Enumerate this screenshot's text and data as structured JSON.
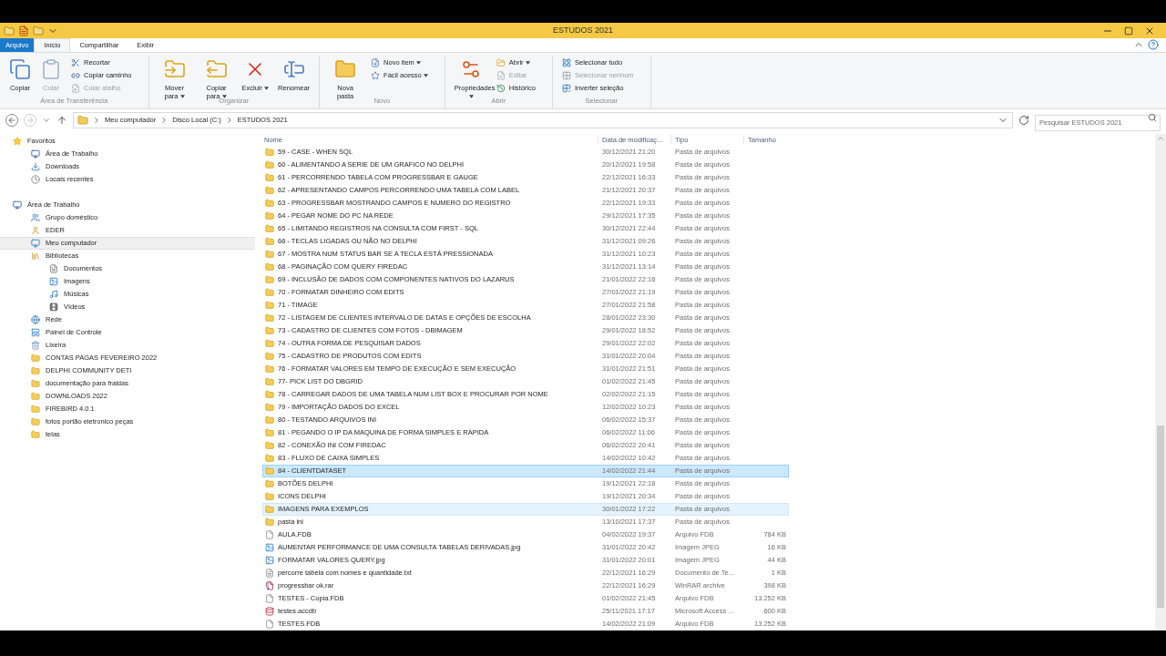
{
  "window": {
    "title": "ESTUDOS 2021"
  },
  "ribbon_tabs": [
    {
      "label": "Arquivo",
      "kind": "file",
      "selected": false
    },
    {
      "label": "Início",
      "kind": "tab",
      "selected": true
    },
    {
      "label": "Compartilhar",
      "kind": "tab",
      "selected": false
    },
    {
      "label": "Exibir",
      "kind": "tab",
      "selected": false
    }
  ],
  "ribbon_groups": [
    {
      "label": "Área de Transferência",
      "items": [
        {
          "label": "Copiar",
          "kind": "large",
          "disabled": false,
          "dropdown": false
        },
        {
          "label": "Colar",
          "kind": "large",
          "disabled": true,
          "dropdown": false
        },
        {
          "label": "Recortar",
          "kind": "small",
          "disabled": false,
          "dropdown": false
        },
        {
          "label": "Copiar caminho",
          "kind": "small",
          "disabled": false,
          "dropdown": false
        },
        {
          "label": "Colar atalho",
          "kind": "small",
          "disabled": true,
          "dropdown": false
        }
      ]
    },
    {
      "label": "Organizar",
      "items": [
        {
          "label": "Mover para",
          "kind": "large",
          "disabled": false,
          "dropdown": true
        },
        {
          "label": "Copiar para",
          "kind": "large",
          "disabled": false,
          "dropdown": true
        },
        {
          "label": "Excluir",
          "kind": "large",
          "disabled": false,
          "dropdown": true
        },
        {
          "label": "Renomear",
          "kind": "large",
          "disabled": false,
          "dropdown": false
        }
      ]
    },
    {
      "label": "Novo",
      "items": [
        {
          "label": "Nova pasta",
          "kind": "large",
          "disabled": false,
          "dropdown": false
        },
        {
          "label": "Novo item",
          "kind": "small",
          "disabled": false,
          "dropdown": true
        },
        {
          "label": "Fácil acesso",
          "kind": "small",
          "disabled": false,
          "dropdown": true
        }
      ]
    },
    {
      "label": "Abrir",
      "items": [
        {
          "label": "Propriedades",
          "kind": "large",
          "disabled": false,
          "dropdown": true
        },
        {
          "label": "Abrir",
          "kind": "small",
          "disabled": false,
          "dropdown": true
        },
        {
          "label": "Editar",
          "kind": "small",
          "disabled": true,
          "dropdown": false
        },
        {
          "label": "Histórico",
          "kind": "small",
          "disabled": false,
          "dropdown": false
        }
      ]
    },
    {
      "label": "Selecionar",
      "items": [
        {
          "label": "Selecionar tudo",
          "kind": "small",
          "disabled": false,
          "dropdown": false
        },
        {
          "label": "Selecionar nenhum",
          "kind": "small",
          "disabled": true,
          "dropdown": false
        },
        {
          "label": "Inverter seleção",
          "kind": "small",
          "disabled": false,
          "dropdown": false
        }
      ]
    }
  ],
  "address_bar": {
    "path": [
      "Meu computador",
      "Disco Local (C:)",
      "ESTUDOS 2021"
    ],
    "search_placeholder": "Pesquisar ESTUDOS 2021"
  },
  "sidebar": [
    {
      "label": "Favoritos",
      "kind": "star",
      "selected": false,
      "children": [
        {
          "label": "Área de Trabalho",
          "kind": "desktop",
          "selected": false
        },
        {
          "label": "Downloads",
          "kind": "download",
          "selected": false
        },
        {
          "label": "Locais recentes",
          "kind": "recent",
          "selected": false
        }
      ]
    },
    {
      "label": "Área de Trabalho",
      "kind": "desktop",
      "selected": false,
      "children": [
        {
          "label": "Grupo doméstico",
          "kind": "homegroup",
          "selected": false
        },
        {
          "label": "EDER",
          "kind": "user",
          "selected": false
        },
        {
          "label": "Meu computador",
          "kind": "computer",
          "selected": true
        },
        {
          "label": "Bibliotecas",
          "kind": "library",
          "selected": false,
          "children": [
            {
              "label": "Documentos",
              "kind": "document",
              "selected": false
            },
            {
              "label": "Imagens",
              "kind": "image",
              "selected": false
            },
            {
              "label": "Músicas",
              "kind": "music",
              "selected": false
            },
            {
              "label": "Vídeos",
              "kind": "video",
              "selected": false
            }
          ]
        },
        {
          "label": "Rede",
          "kind": "network",
          "selected": false
        },
        {
          "label": "Painel de Controle",
          "kind": "control",
          "selected": false
        },
        {
          "label": "Lixeira",
          "kind": "trash",
          "selected": false
        },
        {
          "label": "CONTAS PAGAS FEVEREIRO 2022",
          "kind": "folder",
          "selected": false
        },
        {
          "label": "DELPHI COMMUNITY DETI",
          "kind": "folder",
          "selected": false
        },
        {
          "label": "documentação para fraldas",
          "kind": "folder",
          "selected": false
        },
        {
          "label": "DOWNLOADS 2022",
          "kind": "folder",
          "selected": false
        },
        {
          "label": "FIREBIRD 4.0.1",
          "kind": "folder",
          "selected": false
        },
        {
          "label": "fotos portão eletronico peças",
          "kind": "folder",
          "selected": false
        },
        {
          "label": "telas",
          "kind": "folder",
          "selected": false
        }
      ]
    }
  ],
  "table": {
    "columns": [
      "Nome",
      "Data de modificaç...",
      "Tipo",
      "Tamanho"
    ],
    "rows": [
      {
        "name": "59 - CASE - WHEN SQL",
        "date": "30/12/2021 21:20",
        "type": "Pasta de arquivos",
        "kind": "folder",
        "selected": false,
        "hovered": false
      },
      {
        "name": "60 - ALIMENTANDO A SERIE DE UM GRAFICO NO DELPHI",
        "date": "20/12/2021 19:58",
        "type": "Pasta de arquivos",
        "kind": "folder",
        "selected": false,
        "hovered": false
      },
      {
        "name": "61 - PERCORRENDO TABELA COM PROGRESSBAR E GAUGE",
        "date": "22/12/2021 16:33",
        "type": "Pasta de arquivos",
        "kind": "folder",
        "selected": false,
        "hovered": false
      },
      {
        "name": "62 - APRESENTANDO CAMPOS PERCORRENDO UMA TABELA COM LABEL",
        "date": "21/12/2021 20:37",
        "type": "Pasta de arquivos",
        "kind": "folder",
        "selected": false,
        "hovered": false
      },
      {
        "name": "63 - PROGRESSBAR MOSTRANDO CAMPOS E NUMERO DO REGISTRO",
        "date": "22/12/2021 19:33",
        "type": "Pasta de arquivos",
        "kind": "folder",
        "selected": false,
        "hovered": false
      },
      {
        "name": "64 - PEGAR NOME DO PC NA REDE",
        "date": "29/12/2021 17:35",
        "type": "Pasta de arquivos",
        "kind": "folder",
        "selected": false,
        "hovered": false
      },
      {
        "name": "65 - LIMITANDO REGISTROS NA CONSULTA COM FIRST - SQL",
        "date": "30/12/2021 22:44",
        "type": "Pasta de arquivos",
        "kind": "folder",
        "selected": false,
        "hovered": false
      },
      {
        "name": "66 - TECLAS LIGADAS OU NÃO NO DELPHI",
        "date": "31/12/2021 09:26",
        "type": "Pasta de arquivos",
        "kind": "folder",
        "selected": false,
        "hovered": false
      },
      {
        "name": "67 - MOSTRA NUM STATUS BAR SE A TECLA ESTÁ PRESSIONADA",
        "date": "31/12/2021 10:23",
        "type": "Pasta de arquivos",
        "kind": "folder",
        "selected": false,
        "hovered": false
      },
      {
        "name": "68 - PAGINAÇÃO COM QUERY FIREDAC",
        "date": "31/12/2021 13:14",
        "type": "Pasta de arquivos",
        "kind": "folder",
        "selected": false,
        "hovered": false
      },
      {
        "name": "69 - INCLUSÃO DE DADOS COM COMPONENTES NATIVOS DO LAZARUS",
        "date": "21/01/2022 22:16",
        "type": "Pasta de arquivos",
        "kind": "folder",
        "selected": false,
        "hovered": false
      },
      {
        "name": "70 - FORMATAR DINHEIRO COM EDITS",
        "date": "27/01/2022 21:19",
        "type": "Pasta de arquivos",
        "kind": "folder",
        "selected": false,
        "hovered": false
      },
      {
        "name": "71 - TIMAGE",
        "date": "27/01/2022 21:58",
        "type": "Pasta de arquivos",
        "kind": "folder",
        "selected": false,
        "hovered": false
      },
      {
        "name": "72 - LISTAGEM DE CLIENTES INTERVALO DE DATAS E OPÇÕES DE ESCOLHA",
        "date": "28/01/2022 23:30",
        "type": "Pasta de arquivos",
        "kind": "folder",
        "selected": false,
        "hovered": false
      },
      {
        "name": "73 - CADASTRO DE CLIENTES COM FOTOS - DBIMAGEM",
        "date": "29/01/2022 18:52",
        "type": "Pasta de arquivos",
        "kind": "folder",
        "selected": false,
        "hovered": false
      },
      {
        "name": "74 - OUTRA FORMA DE PESQUISAR DADOS",
        "date": "29/01/2022 22:02",
        "type": "Pasta de arquivos",
        "kind": "folder",
        "selected": false,
        "hovered": false
      },
      {
        "name": "75 - CADASTRO DE PRODUTOS COM EDITS",
        "date": "31/01/2022 20:04",
        "type": "Pasta de arquivos",
        "kind": "folder",
        "selected": false,
        "hovered": false
      },
      {
        "name": "76 - FORMATAR VALORES EM TEMPO DE EXECUÇÃO E SEM EXECUÇÃO",
        "date": "31/01/2022 21:51",
        "type": "Pasta de arquivos",
        "kind": "folder",
        "selected": false,
        "hovered": false
      },
      {
        "name": "77- PICK LIST DO DBGRID",
        "date": "01/02/2022 21:45",
        "type": "Pasta de arquivos",
        "kind": "folder",
        "selected": false,
        "hovered": false
      },
      {
        "name": "78 - CARREGAR DADOS DE UMA TABELA NUM LIST BOX E PROCURAR POR NOME",
        "date": "02/02/2022 21:15",
        "type": "Pasta de arquivos",
        "kind": "folder",
        "selected": false,
        "hovered": false
      },
      {
        "name": "79 - IMPORTAÇÃO DADOS DO EXCEL",
        "date": "12/02/2022 10:23",
        "type": "Pasta de arquivos",
        "kind": "folder",
        "selected": false,
        "hovered": false
      },
      {
        "name": "80 - TESTANDO ARQUIVOS INI",
        "date": "06/02/2022 15:37",
        "type": "Pasta de arquivos",
        "kind": "folder",
        "selected": false,
        "hovered": false
      },
      {
        "name": "81 - PEGANDO O IP DA MAQUINA DE FORMA SIMPLES E RAPIDA",
        "date": "06/02/2022 11:06",
        "type": "Pasta de arquivos",
        "kind": "folder",
        "selected": false,
        "hovered": false
      },
      {
        "name": "82 - CONEXÃO INI COM FIREDAC",
        "date": "06/02/2022 20:41",
        "type": "Pasta de arquivos",
        "kind": "folder",
        "selected": false,
        "hovered": false
      },
      {
        "name": "83 - FLUXO DE CAIXA SIMPLES",
        "date": "14/02/2022 10:42",
        "type": "Pasta de arquivos",
        "kind": "folder",
        "selected": false,
        "hovered": false
      },
      {
        "name": "84 - CLIENTDATASET",
        "date": "14/02/2022 21:44",
        "type": "Pasta de arquivos",
        "kind": "folder",
        "selected": true,
        "hovered": false
      },
      {
        "name": "BOTÕES DELPHI",
        "date": "19/12/2021 22:18",
        "type": "Pasta de arquivos",
        "kind": "folder",
        "selected": false,
        "hovered": false
      },
      {
        "name": "ICONS DELPHI",
        "date": "19/12/2021 20:34",
        "type": "Pasta de arquivos",
        "kind": "folder",
        "selected": false,
        "hovered": false
      },
      {
        "name": "IMAGENS PARA EXEMPLOS",
        "date": "30/01/2022 17:22",
        "type": "Pasta de arquivos",
        "kind": "folder",
        "selected": false,
        "hovered": true
      },
      {
        "name": "pasta ini",
        "date": "13/10/2021 17:37",
        "type": "Pasta de arquivos",
        "kind": "folder",
        "selected": false,
        "hovered": false
      },
      {
        "name": "AULA.FDB",
        "date": "04/02/2022 19:37",
        "type": "Arquivo FDB",
        "size": "784 KB",
        "kind": "file",
        "selected": false,
        "hovered": false
      },
      {
        "name": "AUMENTAR PERFORMANCE DE UMA CONSULTA TABELAS DERIVADAS.jpg",
        "date": "31/01/2022 20:42",
        "type": "Imagem JPEG",
        "size": "16 KB",
        "kind": "image",
        "selected": false,
        "hovered": false
      },
      {
        "name": "FORMATAR VALORES QUERY.jpg",
        "date": "31/01/2022 20:01",
        "type": "Imagem JPEG",
        "size": "44 KB",
        "kind": "image",
        "selected": false,
        "hovered": false
      },
      {
        "name": "percorre tabela com nomes e quantidade.txt",
        "date": "22/12/2021 16:29",
        "type": "Documento de Te...",
        "size": "1 KB",
        "kind": "text",
        "selected": false,
        "hovered": false
      },
      {
        "name": "progressbar ok.rar",
        "date": "22/12/2021 16:29",
        "type": "WinRAR archive",
        "size": "398 KB",
        "kind": "archive",
        "selected": false,
        "hovered": false
      },
      {
        "name": "TESTES - Copia.FDB",
        "date": "01/02/2022 21:45",
        "type": "Arquivo FDB",
        "size": "13.252 KB",
        "kind": "file",
        "selected": false,
        "hovered": false
      },
      {
        "name": "testes.accdb",
        "date": "25/11/2021 17:17",
        "type": "Microsoft Access ...",
        "size": "600 KB",
        "kind": "database",
        "selected": false,
        "hovered": false
      },
      {
        "name": "TESTES.FDB",
        "date": "14/02/2022 21:09",
        "type": "Arquivo FDB",
        "size": "13.252 KB",
        "kind": "file",
        "selected": false,
        "hovered": false
      }
    ]
  }
}
